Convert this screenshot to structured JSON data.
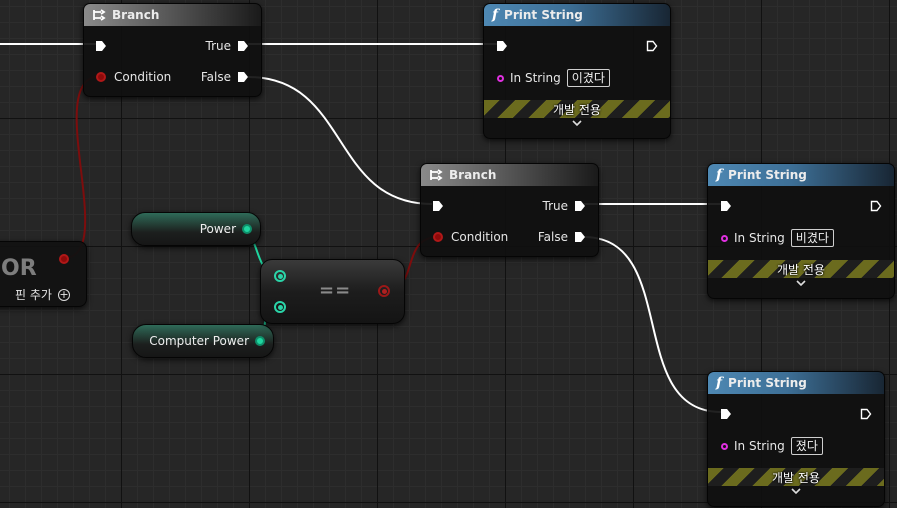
{
  "branch_nodes": [
    {
      "title": "Branch",
      "true_label": "True",
      "condition_label": "Condition",
      "false_label": "False"
    },
    {
      "title": "Branch",
      "true_label": "True",
      "condition_label": "Condition",
      "false_label": "False"
    }
  ],
  "print_nodes": [
    {
      "title": "Print String",
      "in_string_label": "In String",
      "in_string_value": "이겼다",
      "dev_only_label": "개발 전용"
    },
    {
      "title": "Print String",
      "in_string_label": "In String",
      "in_string_value": "비겼다",
      "dev_only_label": "개발 전용"
    },
    {
      "title": "Print String",
      "in_string_label": "In String",
      "in_string_value": "졌다",
      "dev_only_label": "개발 전용"
    }
  ],
  "variables": {
    "power": "Power",
    "computer_power": "Computer Power"
  },
  "equal_node": {
    "label": "=="
  },
  "or_node": {
    "title_fragment": "OR",
    "add_pin_label": "핀 추가"
  },
  "colors": {
    "exec_wire": "#ffffff",
    "bool_wire": "#8a0f0f",
    "int_wire": "#1fd6a0",
    "function_header": "#4e88b3",
    "branch_header": "#8a8a8a"
  }
}
